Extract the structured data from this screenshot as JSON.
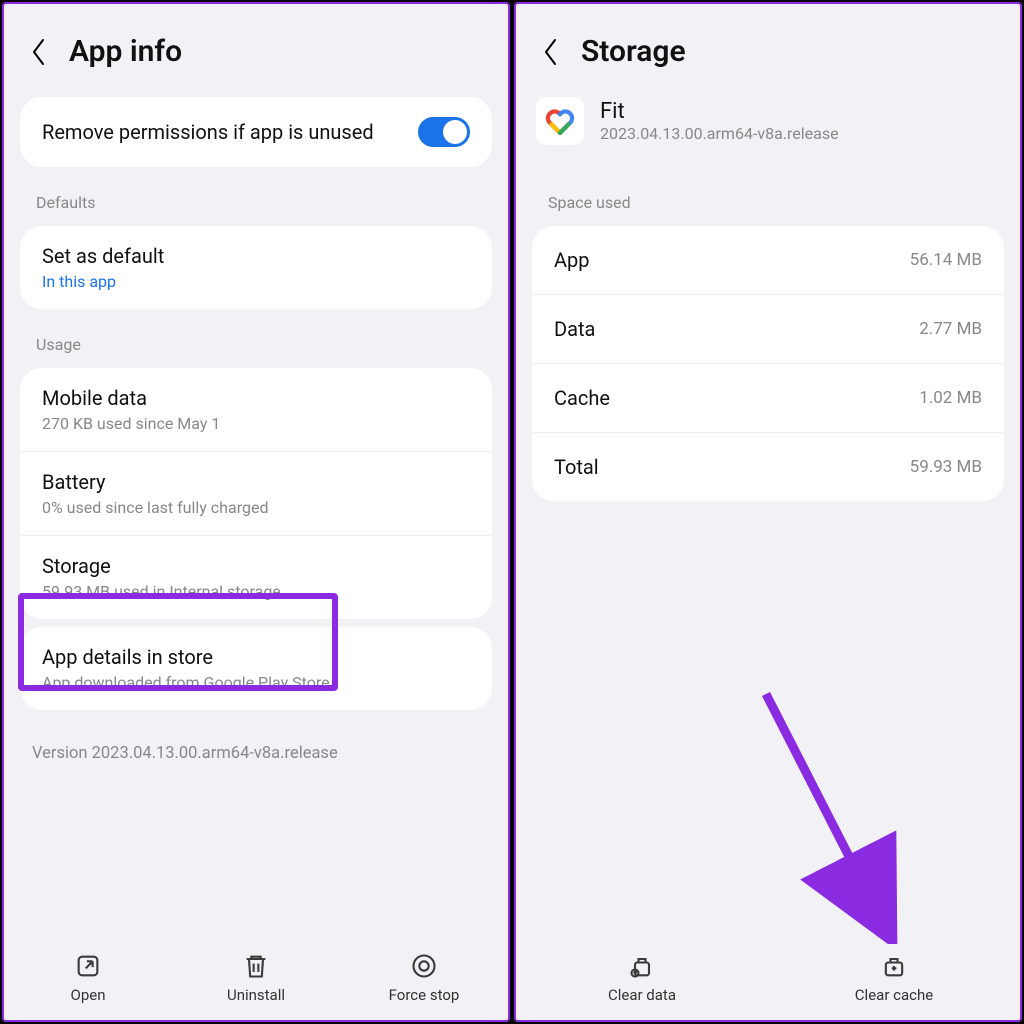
{
  "left": {
    "title": "App info",
    "remove_permissions_label": "Remove permissions if app is unused",
    "section_defaults": "Defaults",
    "set_default_title": "Set as default",
    "set_default_sub": "In this app",
    "section_usage": "Usage",
    "mobile_data_title": "Mobile data",
    "mobile_data_sub": "270 KB used since May 1",
    "battery_title": "Battery",
    "battery_sub": "0% used since last fully charged",
    "storage_title": "Storage",
    "storage_sub": "59.93 MB used in Internal storage",
    "app_details_title": "App details in store",
    "app_details_sub": "App downloaded from Google Play Store",
    "version_text": "Version 2023.04.13.00.arm64-v8a.release",
    "btn_open": "Open",
    "btn_uninstall": "Uninstall",
    "btn_force_stop": "Force stop"
  },
  "right": {
    "title": "Storage",
    "app_name": "Fit",
    "app_version": "2023.04.13.00.arm64-v8a.release",
    "section_space": "Space used",
    "rows": {
      "app_label": "App",
      "app_value": "56.14 MB",
      "data_label": "Data",
      "data_value": "2.77 MB",
      "cache_label": "Cache",
      "cache_value": "1.02 MB",
      "total_label": "Total",
      "total_value": "59.93 MB"
    },
    "btn_clear_data": "Clear data",
    "btn_clear_cache": "Clear cache"
  }
}
